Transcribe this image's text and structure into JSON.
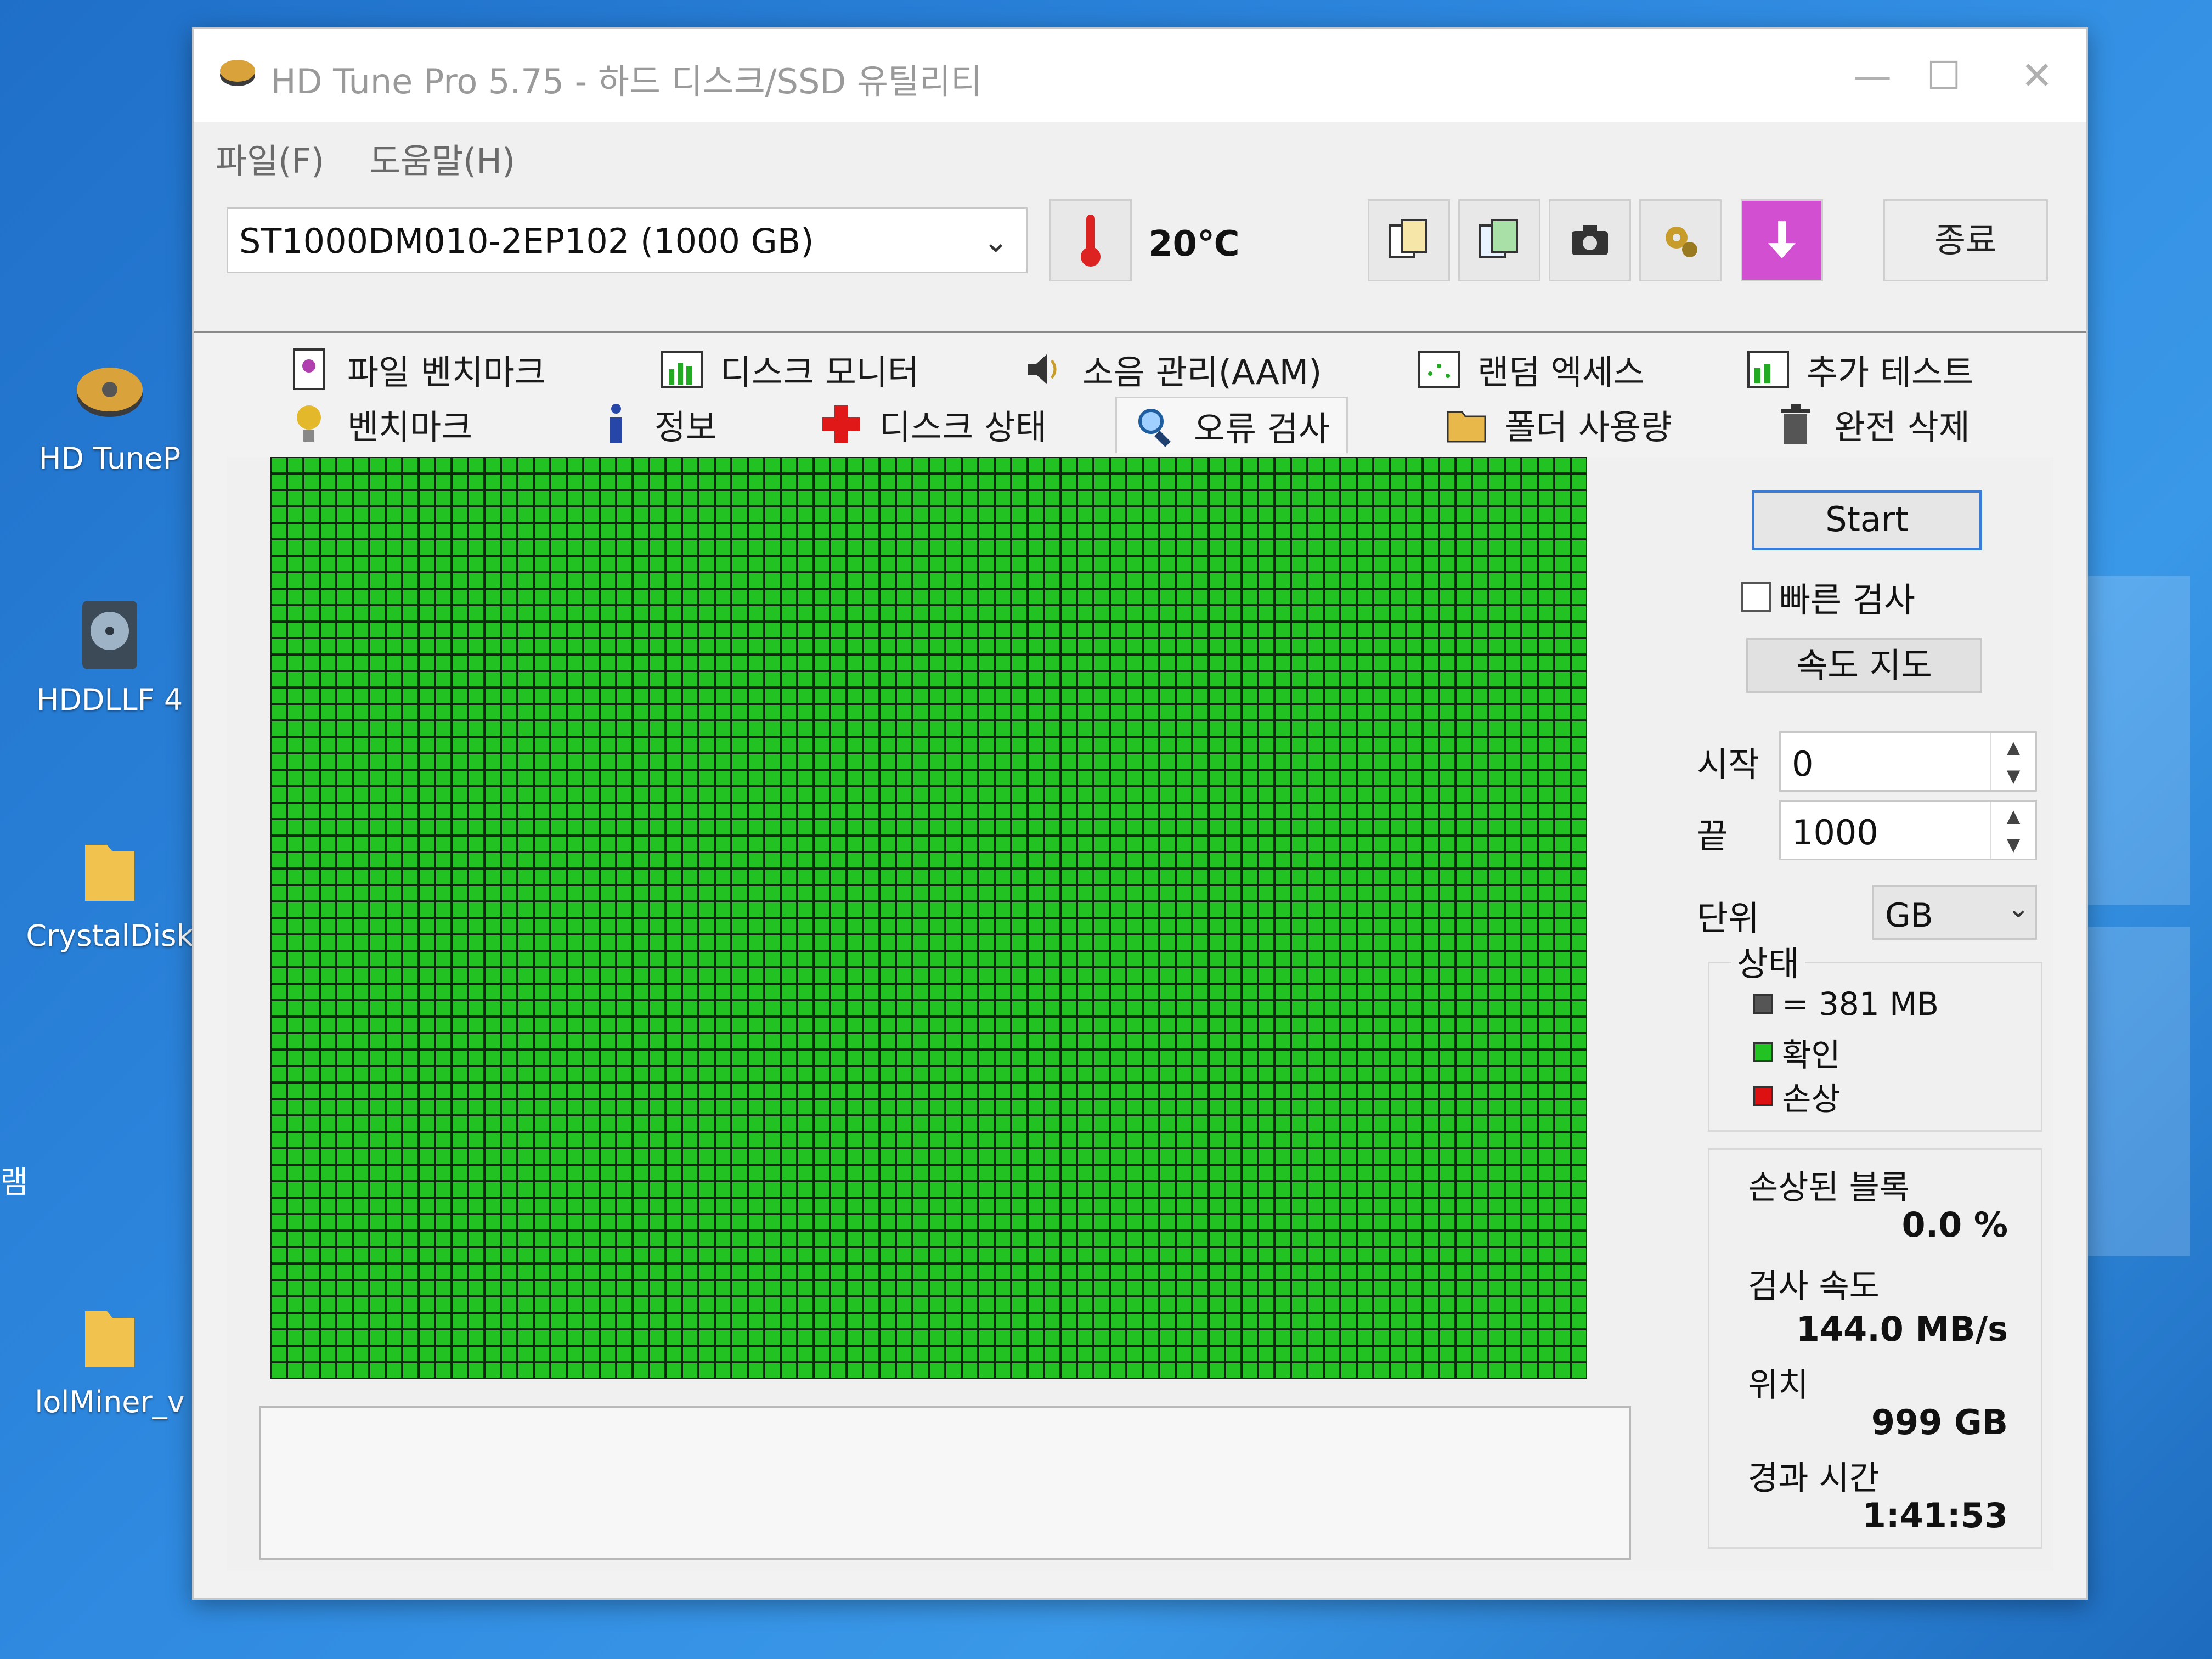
{
  "desktop": {
    "icons": [
      {
        "label": "HD TuneP"
      },
      {
        "label": "HDDLLF 4"
      },
      {
        "label": "CrystalDisk"
      },
      {
        "label": "lolMiner_v"
      }
    ],
    "side_text": "램"
  },
  "window": {
    "title": "HD Tune Pro 5.75 - 하드 디스크/SSD 유틸리티",
    "minimize": "—",
    "maximize": "☐",
    "close": "✕"
  },
  "menu": {
    "file": "파일(F)",
    "help": "도움말(H)"
  },
  "toolbar": {
    "drive": "ST1000DM010-2EP102 (1000 GB)",
    "temperature": "20℃",
    "exit_label": "종료",
    "icons": [
      "copy-icon",
      "copy-all-icon",
      "screenshot-icon",
      "options-icon",
      "save-icon"
    ]
  },
  "tabs": {
    "row1": [
      {
        "label": "파일 벤치마크",
        "icon": "file-benchmark-icon"
      },
      {
        "label": "디스크 모니터",
        "icon": "disk-monitor-icon"
      },
      {
        "label": "소음 관리(AAM)",
        "icon": "speaker-icon"
      },
      {
        "label": "랜덤 엑세스",
        "icon": "random-access-icon"
      },
      {
        "label": "추가 테스트",
        "icon": "extra-tests-icon"
      }
    ],
    "row2": [
      {
        "label": "벤치마크",
        "icon": "benchmark-icon"
      },
      {
        "label": "정보",
        "icon": "info-icon"
      },
      {
        "label": "디스크 상태",
        "icon": "health-icon"
      },
      {
        "label": "오류 검사",
        "icon": "magnifier-icon"
      },
      {
        "label": "폴더 사용량",
        "icon": "folder-icon"
      },
      {
        "label": "완전 삭제",
        "icon": "trash-icon"
      }
    ],
    "active": "오류 검사"
  },
  "error_scan": {
    "grid_color": "#22c222",
    "grid_line_color": "#0c2b0c",
    "start_label": "Start",
    "quick_scan_label": "빠른 검사",
    "quick_scan_checked": false,
    "speed_map_label": "속도 지도",
    "start_field_label": "시작",
    "start_value": "0",
    "end_field_label": "끝",
    "end_value": "1000",
    "unit_label": "단위",
    "unit_value": "GB",
    "legend": {
      "title": "상태",
      "block_size": "= 381 MB",
      "ok": "확인",
      "damaged": "손상",
      "block_color": "#555555",
      "ok_color": "#22c222",
      "damaged_color": "#dd1111"
    },
    "stats": {
      "damaged_blocks_label": "손상된 블록",
      "damaged_blocks_value": "0.0 %",
      "scan_speed_label": "검사 속도",
      "scan_speed_value": "144.0 MB/s",
      "position_label": "위치",
      "position_value": "999 GB",
      "elapsed_label": "경과 시간",
      "elapsed_value": "1:41:53"
    }
  }
}
